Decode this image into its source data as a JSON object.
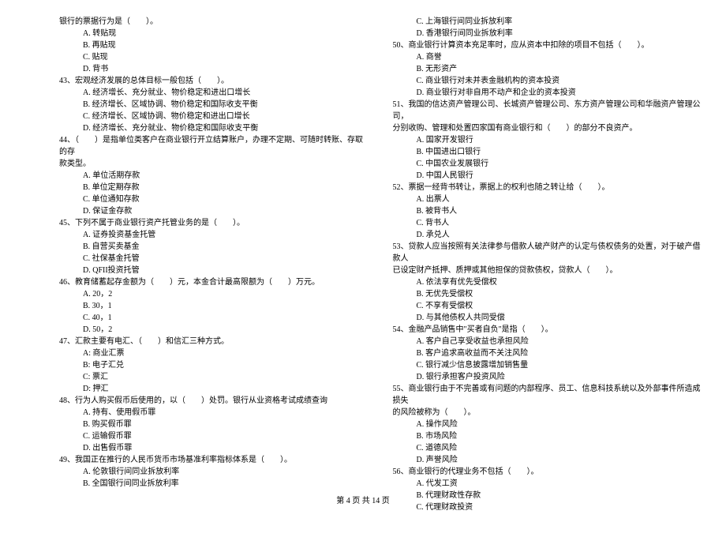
{
  "footer": "第 4 页 共 14 页",
  "left_lines": [
    {
      "indent": 0,
      "text": "银行的票据行为是（　　）。"
    },
    {
      "indent": 2,
      "text": "A. 转贴现"
    },
    {
      "indent": 2,
      "text": "B. 再贴现"
    },
    {
      "indent": 2,
      "text": "C. 贴现"
    },
    {
      "indent": 2,
      "text": "D. 背书"
    },
    {
      "indent": 0,
      "text": "43、宏观经济发展的总体目标一般包括（　　）。"
    },
    {
      "indent": 2,
      "text": "A. 经济增长、充分就业、物价稳定和进出口增长"
    },
    {
      "indent": 2,
      "text": "B. 经济增长、区域协调、物价稳定和国际收支平衡"
    },
    {
      "indent": 2,
      "text": "C. 经济增长、区域协调、物价稳定和进出口增长"
    },
    {
      "indent": 2,
      "text": "D. 经济增长、充分就业、物价稳定和国际收支平衡"
    },
    {
      "indent": 0,
      "text": "44、（　　）是指单位类客户在商业银行开立结算账户，办理不定期、可随时转账、存取的存"
    },
    {
      "indent": 0,
      "text": "款类型。"
    },
    {
      "indent": 2,
      "text": "A. 单位活期存款"
    },
    {
      "indent": 2,
      "text": "B. 单位定期存款"
    },
    {
      "indent": 2,
      "text": "C. 单位通知存款"
    },
    {
      "indent": 2,
      "text": "D. 保证金存款"
    },
    {
      "indent": 0,
      "text": "45、下列不属于商业银行资产托管业务的是（　　）。"
    },
    {
      "indent": 2,
      "text": "A. 证券投资基金托管"
    },
    {
      "indent": 2,
      "text": "B. 自营买卖基金"
    },
    {
      "indent": 2,
      "text": "C. 社保基金托管"
    },
    {
      "indent": 2,
      "text": "D. QFII投资托管"
    },
    {
      "indent": 0,
      "text": "46、教育储蓄起存金额为（　　）元，本金合计最高限额为（　　）万元。"
    },
    {
      "indent": 2,
      "text": "A. 20，2"
    },
    {
      "indent": 2,
      "text": "B. 30，1"
    },
    {
      "indent": 2,
      "text": "C. 40，1"
    },
    {
      "indent": 2,
      "text": "D. 50，2"
    },
    {
      "indent": 0,
      "text": "47、汇款主要有电汇、（　　）和信汇三种方式。"
    },
    {
      "indent": 2,
      "text": "A: 商业汇票"
    },
    {
      "indent": 2,
      "text": "B: 电子汇兑"
    },
    {
      "indent": 2,
      "text": "C: 票汇"
    },
    {
      "indent": 2,
      "text": "D: 押汇"
    },
    {
      "indent": 0,
      "text": "48、行为人购买假币后使用的，以（　　）处罚。银行从业资格考试成绩查询"
    },
    {
      "indent": 2,
      "text": "A. 持有、使用假币罪"
    },
    {
      "indent": 2,
      "text": "B. 购买假币罪"
    },
    {
      "indent": 2,
      "text": "C. 运输假币罪"
    },
    {
      "indent": 2,
      "text": "D. 出售假币罪"
    },
    {
      "indent": 0,
      "text": "49、我国正在推行的人民币货币市场基准利率指标体系是（　　）。"
    },
    {
      "indent": 2,
      "text": "A. 伦敦银行间同业拆放利率"
    },
    {
      "indent": 2,
      "text": "B. 全国银行间同业拆放利率"
    }
  ],
  "right_lines": [
    {
      "indent": 2,
      "text": "C. 上海银行间同业拆放利率"
    },
    {
      "indent": 2,
      "text": "D. 香港银行间同业拆放利率"
    },
    {
      "indent": 0,
      "text": "50、商业银行计算资本充足率时，应从资本中扣除的项目不包括（　　）。"
    },
    {
      "indent": 2,
      "text": "A. 商誉"
    },
    {
      "indent": 2,
      "text": "B. 无形资产"
    },
    {
      "indent": 2,
      "text": "C. 商业银行对未并表金融机构的资本投资"
    },
    {
      "indent": 2,
      "text": "D. 商业银行对非自用不动产和企业的资本投资"
    },
    {
      "indent": 0,
      "text": "51、我国的信达资产管理公司、长城资产管理公司、东方资产管理公司和华融资产管理公司，"
    },
    {
      "indent": 0,
      "text": "分别收购、管理和处置四家国有商业银行和（　　）的部分不良资产。"
    },
    {
      "indent": 2,
      "text": "A. 国家开发银行"
    },
    {
      "indent": 2,
      "text": "B. 中国进出口银行"
    },
    {
      "indent": 2,
      "text": "C. 中国农业发展银行"
    },
    {
      "indent": 2,
      "text": "D. 中国人民银行"
    },
    {
      "indent": 0,
      "text": "52、票据一经背书转让，票据上的权利也随之转让给（　　）。"
    },
    {
      "indent": 2,
      "text": "A. 出票人"
    },
    {
      "indent": 2,
      "text": "B. 被背书人"
    },
    {
      "indent": 2,
      "text": "C. 背书人"
    },
    {
      "indent": 2,
      "text": "D. 承兑人"
    },
    {
      "indent": 0,
      "text": "53、贷款人应当按照有关法律参与借款人破产财产的认定与债权债务的处置，对于破产借款人"
    },
    {
      "indent": 0,
      "text": "已设定财产抵押、质押或其他担保的贷款债权，贷款人（　　）。"
    },
    {
      "indent": 2,
      "text": "A. 依法享有优先受偿权"
    },
    {
      "indent": 2,
      "text": "B. 无优先受偿权"
    },
    {
      "indent": 2,
      "text": "C. 不享有受偿权"
    },
    {
      "indent": 2,
      "text": "D. 与其他债权人共同受偿"
    },
    {
      "indent": 0,
      "text": "54、金融产品销售中\"买者自负\"是指（　　）。"
    },
    {
      "indent": 2,
      "text": "A. 客户自己享受收益也承担风险"
    },
    {
      "indent": 2,
      "text": "B. 客户追求高收益而不关注风险"
    },
    {
      "indent": 2,
      "text": "C. 银行减少信息披露增加销售量"
    },
    {
      "indent": 2,
      "text": "D. 银行承担客户投资风险"
    },
    {
      "indent": 0,
      "text": "55、商业银行由于不完善或有问题的内部程序、员工、信息科技系统以及外部事件所造成损失"
    },
    {
      "indent": 0,
      "text": "的风险被称为（　　）。"
    },
    {
      "indent": 2,
      "text": "A. 操作风险"
    },
    {
      "indent": 2,
      "text": "B. 市场风险"
    },
    {
      "indent": 2,
      "text": "C. 道德风险"
    },
    {
      "indent": 2,
      "text": "D. 声誉风险"
    },
    {
      "indent": 0,
      "text": "56、商业银行的代理业务不包括（　　）。"
    },
    {
      "indent": 2,
      "text": "A. 代发工资"
    },
    {
      "indent": 2,
      "text": "B. 代理财政性存款"
    },
    {
      "indent": 2,
      "text": "C. 代理财政投资"
    }
  ]
}
